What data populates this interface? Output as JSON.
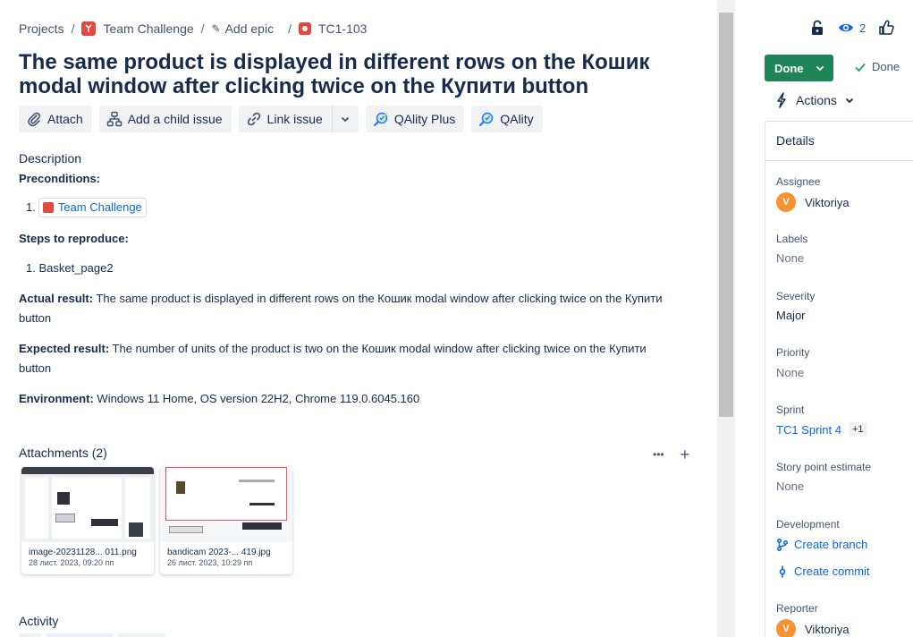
{
  "breadcrumb": {
    "projects": "Projects",
    "sep": "/",
    "project": "Team Challenge",
    "add_epic": "Add epic",
    "issue_key": "TC1-103"
  },
  "issue": {
    "title": "The same product is displayed in different rows on the Кошик modal window after clicking twice on the Купити button"
  },
  "toolbar": {
    "attach": "Attach",
    "add_child": "Add a child issue",
    "link_issue": "Link issue",
    "qality_plus": "QAlity Plus",
    "qality": "QAlity"
  },
  "description": {
    "label": "Description",
    "preconditions_label": "Preconditions:",
    "precondition_num": "1.",
    "precondition_link": "Team Challenge",
    "steps_label": "Steps to reproduce:",
    "step_1": "1. Basket_page2",
    "actual_label": "Actual result:",
    "actual_text": "The same product is displayed in different rows on the Кошик modal window after clicking twice on the Купити",
    "actual_text_2": "button",
    "expected_label": "Expected result:",
    "expected_text": "The number of units of the product is two on the Кошик modal window after clicking twice on the Купити",
    "expected_text_2": "button",
    "environment_label": "Environment:",
    "environment_text": "Windows 11 Home, OS version 22H2, Chrome 119.0.6045.160"
  },
  "attachments": {
    "header": "Attachments (2)",
    "more": "•••",
    "add": "+",
    "items": [
      {
        "name": "image-20231128... 011.png",
        "date": "28 лист. 2023, 09:20 пп"
      },
      {
        "name": "bandicam 2023-... 419.jpg",
        "date": "26 лист. 2023, 10:29 пп"
      }
    ]
  },
  "activity": {
    "label": "Activity"
  },
  "sidebar": {
    "watch_count": "2",
    "status_button": "Done",
    "resolution": "Done",
    "actions": "Actions",
    "details": "Details",
    "assignee_label": "Assignee",
    "assignee": "Viktoriya",
    "assignee_initial": "V",
    "labels_label": "Labels",
    "labels": "None",
    "severity_label": "Severity",
    "severity": "Major",
    "priority_label": "Priority",
    "priority": "None",
    "sprint_label": "Sprint",
    "sprint": "TC1 Sprint 4",
    "sprint_more": "+1",
    "story_points_label": "Story point estimate",
    "story_points": "None",
    "development_label": "Development",
    "create_branch": "Create branch",
    "create_commit": "Create commit",
    "reporter_label": "Reporter",
    "reporter": "Viktoriya",
    "reporter_initial": "V"
  },
  "colors": {
    "accent": "#0c66e4",
    "done_green": "#1f845a",
    "bug_red": "#e2483d",
    "avatar_orange": "#f79232"
  }
}
